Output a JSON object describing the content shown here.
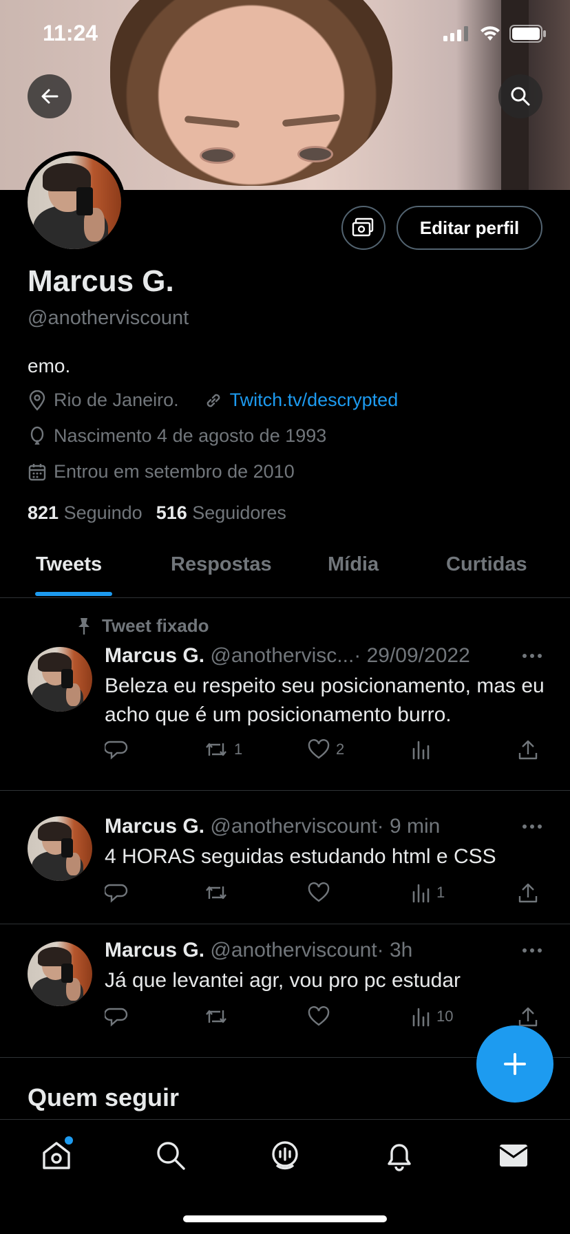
{
  "status_bar": {
    "time": "11:24"
  },
  "profile": {
    "name": "Marcus G.",
    "handle": "@anotherviscount",
    "bio": "emo.",
    "location": "Rio de Janeiro.",
    "website": "Twitch.tv/descrypted",
    "birthday": "Nascimento 4 de agosto de 1993",
    "joined": "Entrou em setembro de 2010",
    "following_count": "821",
    "following_label": "Seguindo",
    "followers_count": "516",
    "followers_label": "Seguidores",
    "edit_button": "Editar perfil"
  },
  "tabs": [
    {
      "label": "Tweets",
      "active": true
    },
    {
      "label": "Respostas",
      "active": false
    },
    {
      "label": "Mídia",
      "active": false
    },
    {
      "label": "Curtidas",
      "active": false
    }
  ],
  "pinned_label": "Tweet fixado",
  "tweets": [
    {
      "name": "Marcus G.",
      "handle": "@anothervisc...",
      "time": "· 29/09/2022",
      "text": "Beleza eu respeito seu posicionamento, mas eu acho que é um posicionamento burro.",
      "retweets": "1",
      "likes": "2",
      "views": ""
    },
    {
      "name": "Marcus G.",
      "handle": "@anotherviscount",
      "time": "· 9 min",
      "text": "4 HORAS seguidas estudando html e CSS",
      "retweets": "",
      "likes": "",
      "views": "1"
    },
    {
      "name": "Marcus G.",
      "handle": "@anotherviscount",
      "time": "· 3h",
      "text": "Já que levantei agr, vou pro pc estudar",
      "retweets": "",
      "likes": "",
      "views": "10"
    }
  ],
  "who_to_follow": "Quem seguir",
  "colors": {
    "accent": "#1d9bf0",
    "background": "#000000",
    "muted": "#71767b",
    "text": "#e7e9ea"
  },
  "icons": [
    "back-arrow-icon",
    "search-icon",
    "tip-jar-icon",
    "location-icon",
    "link-icon",
    "balloon-icon",
    "calendar-icon",
    "pin-icon",
    "reply-icon",
    "retweet-icon",
    "like-icon",
    "views-icon",
    "share-icon",
    "more-icon",
    "compose-plus-icon",
    "home-icon",
    "spaces-icon",
    "bell-icon",
    "mail-icon"
  ]
}
